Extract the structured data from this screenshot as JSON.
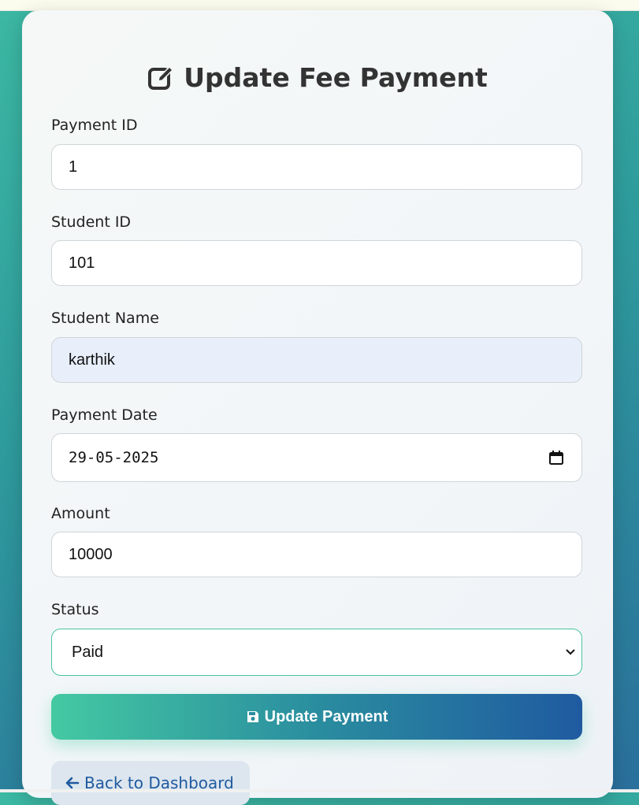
{
  "form": {
    "title": "Update Fee Payment",
    "fields": {
      "payment_id": {
        "label": "Payment ID",
        "value": "1"
      },
      "student_id": {
        "label": "Student ID",
        "value": "101"
      },
      "student_name": {
        "label": "Student Name",
        "value": "karthik"
      },
      "payment_date": {
        "label": "Payment Date",
        "value": "29-05-2025"
      },
      "amount": {
        "label": "Amount",
        "value": "10000"
      },
      "status": {
        "label": "Status",
        "value": "Paid"
      }
    },
    "submit_label": "Update Payment",
    "back_label": "Back to Dashboard"
  },
  "icons": {
    "title": "edit-icon",
    "submit": "save-icon",
    "back": "arrow-left-icon",
    "date": "calendar-icon",
    "select": "chevron-down-icon"
  },
  "colors": {
    "accent_start": "#44c9a2",
    "accent_end": "#1f5aa0",
    "link": "#1f5aa0",
    "autofill_bg": "#e8effb"
  }
}
